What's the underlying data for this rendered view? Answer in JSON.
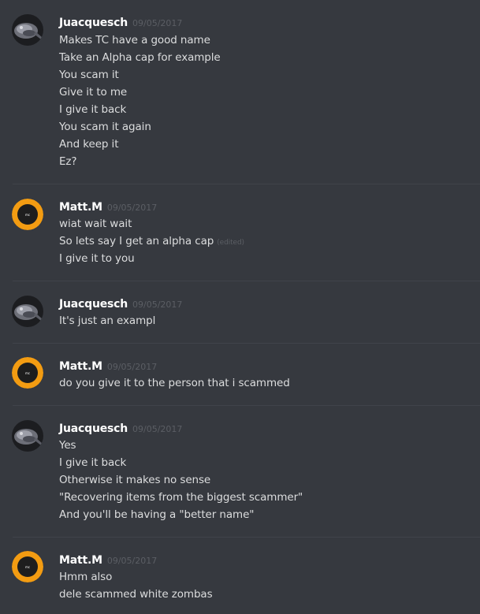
{
  "colors": {
    "background": "#36393f",
    "divider": "#40434a",
    "username": "#ffffff",
    "message_text": "#dcddde",
    "timestamp": "#5b5e64",
    "avatar_orange": "#f39c12"
  },
  "messages": [
    {
      "author": "Juacquesch",
      "avatar": "stingray-photo-avatar",
      "timestamp": "09/05/2017",
      "lines": [
        "Makes TC have a good name",
        "Take an Alpha cap for example",
        "You scam it",
        "Give it to me",
        "I give it back",
        "You scam it again",
        "And keep it",
        "Ez?"
      ]
    },
    {
      "author": "Matt.M",
      "avatar": "orange-logo-avatar",
      "timestamp": "09/05/2017",
      "lines": [
        "wiat wait wait",
        "So lets say I get an alpha cap",
        "I give it to you"
      ],
      "edited_label": "(edited)"
    },
    {
      "author": "Juacquesch",
      "avatar": "stingray-photo-avatar",
      "timestamp": "09/05/2017",
      "lines": [
        "It's just an exampl"
      ]
    },
    {
      "author": "Matt.M",
      "avatar": "orange-logo-avatar",
      "timestamp": "09/05/2017",
      "lines": [
        "do you give it to the person that i scammed"
      ]
    },
    {
      "author": "Juacquesch",
      "avatar": "stingray-photo-avatar",
      "timestamp": "09/05/2017",
      "lines": [
        "Yes",
        "I give it back",
        "Otherwise it makes no sense",
        "\"Recovering items from the biggest scammer\"",
        "And you'll be having a \"better name\""
      ]
    },
    {
      "author": "Matt.M",
      "avatar": "orange-logo-avatar",
      "timestamp": "09/05/2017",
      "lines": [
        "Hmm also",
        "dele scammed white zombas"
      ]
    }
  ]
}
